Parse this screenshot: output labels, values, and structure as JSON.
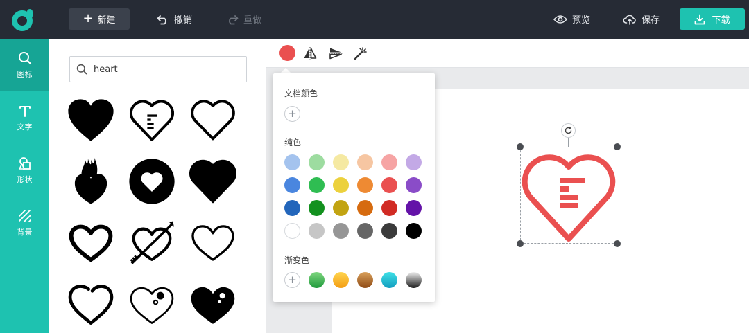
{
  "header": {
    "new_label": "新建",
    "undo_label": "撤销",
    "redo_label": "重做",
    "preview_label": "预览",
    "save_label": "保存",
    "download_label": "下载"
  },
  "sidebar": {
    "items": [
      {
        "label": "图标",
        "icon": "search-icon",
        "active": true
      },
      {
        "label": "文字",
        "icon": "text-icon",
        "active": false
      },
      {
        "label": "形状",
        "icon": "shapes-icon",
        "active": false
      },
      {
        "label": "背景",
        "icon": "background-icon",
        "active": false
      }
    ]
  },
  "search": {
    "value": "heart",
    "icon": "search-icon"
  },
  "icon_results": [
    "heart-solid-icon",
    "heart-outline-lines-icon",
    "heart-outline-icon",
    "flaming-heart-icon",
    "heart-in-circle-icon",
    "heart-solid-rounded-icon",
    "heart-bold-outline-icon",
    "heart-arrow-icon",
    "heart-thin-outline-icon",
    "heart-open-outline-icon",
    "heart-bubbles-outline-icon",
    "heart-bubbles-solid-icon"
  ],
  "toolbar": {
    "current_color": "#ea5050",
    "tools": [
      "flip-horizontal-icon",
      "flip-vertical-icon",
      "magic-wand-icon"
    ]
  },
  "color_picker": {
    "document_colors_title": "文档颜色",
    "solid_title": "纯色",
    "gradient_title": "渐变色",
    "solid_colors": [
      [
        "#a4c3ee",
        "#9ddca0",
        "#f5e9a2",
        "#f6c6a2",
        "#f6a4a4",
        "#c3a9e6"
      ],
      [
        "#4a86df",
        "#2fbd52",
        "#ecd13d",
        "#ee8a33",
        "#ea5050",
        "#8a4cc8"
      ],
      [
        "#2366bb",
        "#13911f",
        "#c2a412",
        "#d66b0f",
        "#d12b24",
        "#6413a8"
      ],
      [
        "#ffffff",
        "#c6c6c6",
        "#969696",
        "#666666",
        "#3b3b3b",
        "#000000"
      ]
    ],
    "gradients": [
      [
        "#7fd67f",
        "#1f9a3c"
      ],
      [
        "#ffd54f",
        "#f39c12"
      ],
      [
        "#d9a05b",
        "#8e4a14"
      ],
      [
        "#3ee0e6",
        "#139dbf"
      ],
      [
        "#f0f0f0",
        "#1c1c1c"
      ]
    ]
  },
  "canvas": {
    "selected_icon": "heart-outline-lines-icon",
    "icon_color": "#ea5050"
  }
}
